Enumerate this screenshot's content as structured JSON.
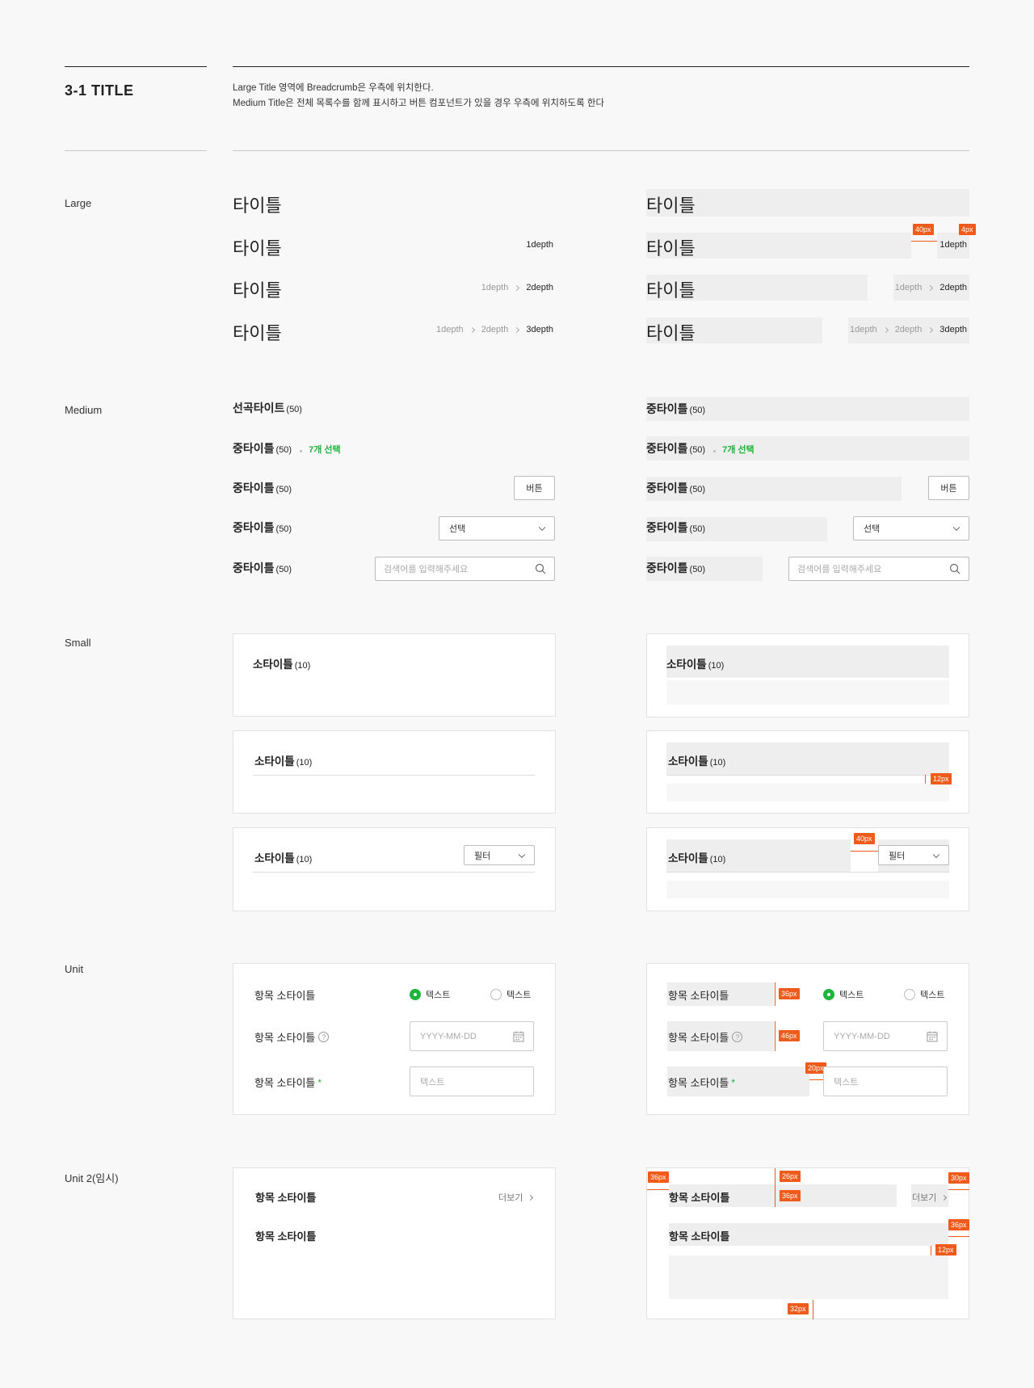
{
  "header": {
    "title": "3-1 TITLE",
    "desc_line1": "Large Title 영역에 Breadcrumb은 우측에 위치한다.",
    "desc_line2": "Medium Title은 전체 목록수를 함께 표시하고 버튼 컴포넌트가 있을 경우 우측에 위치하도록 한다"
  },
  "labels": {
    "large": "Large",
    "medium": "Medium",
    "small": "Small",
    "unit": "Unit",
    "unit2": "Unit 2(임시)"
  },
  "large": {
    "title": "타이틀",
    "crumb1": "1depth",
    "crumb2": "2depth",
    "crumb3": "3depth"
  },
  "medium": {
    "title_alt": "선곡타이트",
    "title": "중타이틀",
    "count": "(50)",
    "selected": "7개 선택",
    "button": "버튼",
    "select": "선택",
    "search_placeholder": "검색어를 입력해주세요"
  },
  "small": {
    "title": "소타이틀",
    "count": "(10)",
    "filter": "필터"
  },
  "unit": {
    "item": "항목 소타이틀",
    "radio1": "텍스트",
    "radio2": "텍스트",
    "date_placeholder": "YYYY-MM-DD",
    "text_placeholder": "텍스트",
    "required_mark": "*",
    "help_mark": "?"
  },
  "unit2": {
    "item1": "항목 소타이틀",
    "item2": "항목 소타이틀",
    "more": "더보기"
  },
  "specs": {
    "s40a": "40px",
    "s4": "4px",
    "s12a": "12px",
    "s40b": "40px",
    "s36a": "36px",
    "s46": "46px",
    "s20": "20px",
    "s36b": "36px",
    "s26": "26px",
    "s36c": "36px",
    "s30": "30px",
    "s36d": "36px",
    "s12b": "12px",
    "s32": "32px"
  },
  "colors": {
    "accent_green": "#1fb53c",
    "spec_orange": "#f05a1a",
    "guide_gray": "#eeeeee"
  }
}
